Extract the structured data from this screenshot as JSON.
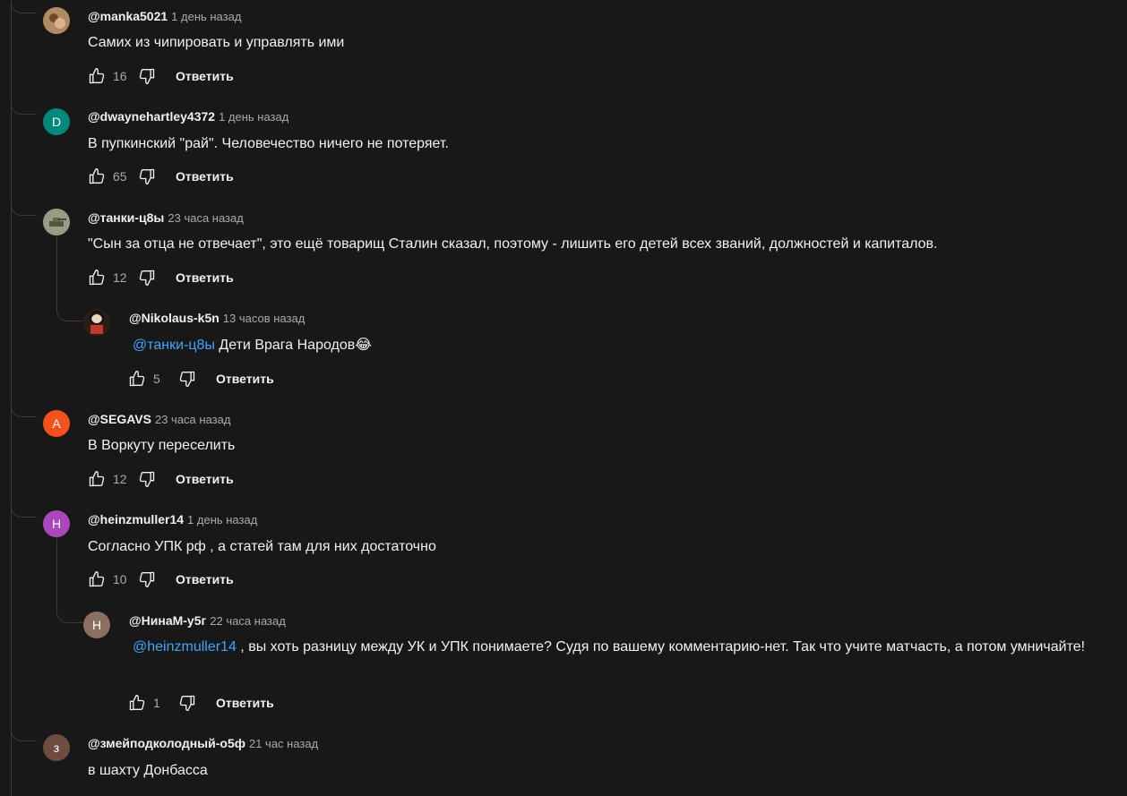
{
  "comments": [
    {
      "author": "@manka5021",
      "time": "1 день назад",
      "text": "Самих из чипировать и управлять ими",
      "likes": "16",
      "reply": "Ответить",
      "avatar_letter": "",
      "avatar_color": "#8a6a4a"
    },
    {
      "author": "@dwaynehartley4372",
      "time": "1 день назад",
      "text": "В пупкинский \"рай\". Человечество ничего не потеряет.",
      "likes": "65",
      "reply": "Ответить",
      "avatar_letter": "D",
      "avatar_color": "#00897b"
    },
    {
      "author": "@танки-ц8ы",
      "time": "23 часа назад",
      "text": "\"Сын за отца не отвечает\", это ещё товарищ Сталин сказал, поэтому - лишить его детей всех званий, должностей и капиталов.",
      "likes": "12",
      "reply": "Ответить",
      "avatar_letter": "",
      "avatar_color": "#7c7c6a"
    },
    {
      "author": "@Nikolaus-k5n",
      "time": "13 часов назад",
      "mention": "@танки-ц8ы",
      "text": " Дети Врага Народов😂",
      "likes": "5",
      "reply": "Ответить",
      "avatar_letter": "",
      "avatar_color": "#3a2a20"
    },
    {
      "author": "@SEGAVS",
      "time": "23 часа назад",
      "text": "В Воркуту переселить",
      "likes": "12",
      "reply": "Ответить",
      "avatar_letter": "A",
      "avatar_color": "#f4511e"
    },
    {
      "author": "@heinzmuller14",
      "time": "1 день назад",
      "text": "Согласно УПК рф , а статей там для них достаточно",
      "likes": "10",
      "reply": "Ответить",
      "avatar_letter": "H",
      "avatar_color": "#ab47bc"
    },
    {
      "author": "@НинаМ-у5г",
      "time": "22 часа назад",
      "mention": "@heinzmuller14",
      "text": " , вы хоть разницу между УК и УПК понимаете? Судя по вашему комментарию-нет. Так что учите матчасть, а потом умничайте!",
      "likes": "1",
      "reply": "Ответить",
      "avatar_letter": "Н",
      "avatar_color": "#8d6e63"
    },
    {
      "author": "@змейподколодный-о5ф",
      "time": "21 час назад",
      "text": "в шахту Донбасса",
      "avatar_letter": "з",
      "avatar_color": "#6d4c41"
    }
  ]
}
